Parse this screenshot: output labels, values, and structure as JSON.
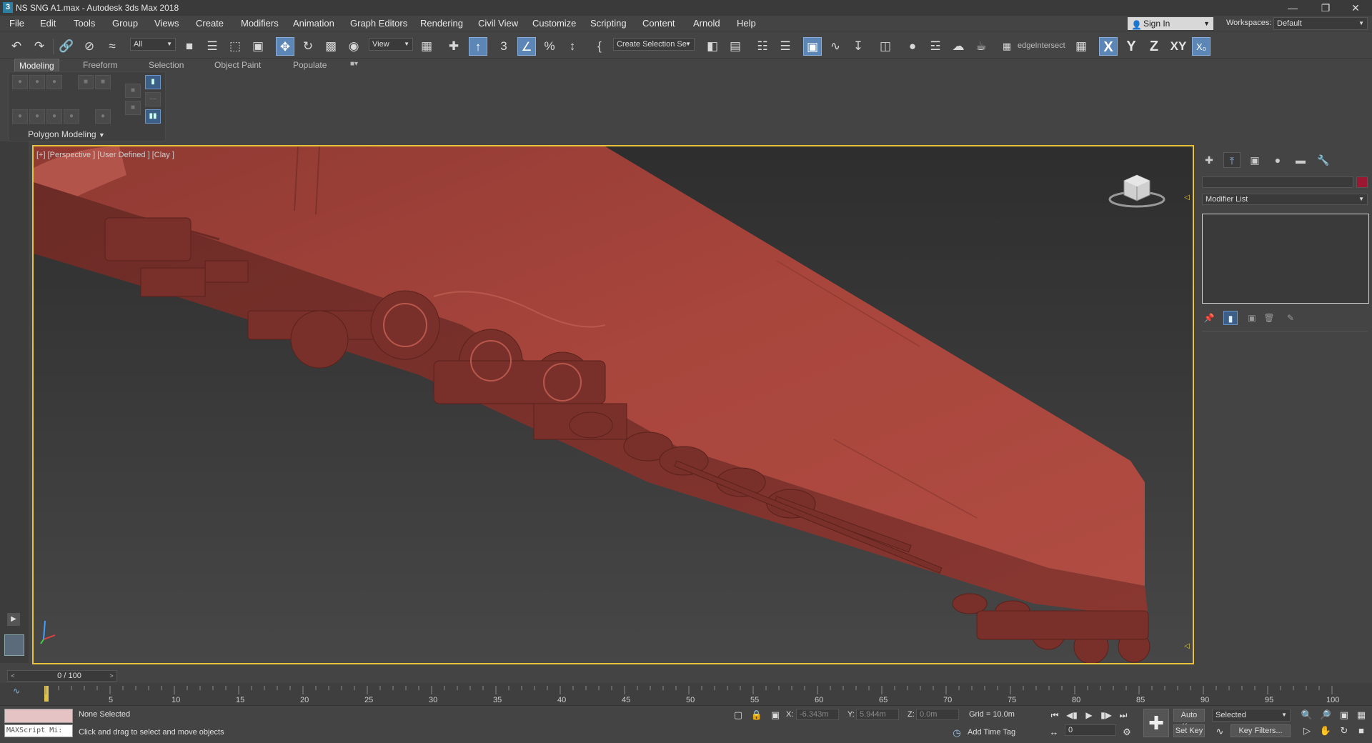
{
  "window": {
    "title": "NS SNG A1.max - Autodesk 3ds Max 2018",
    "app_icon": "3",
    "controls": [
      "minimize",
      "restore",
      "close"
    ]
  },
  "menu": [
    "File",
    "Edit",
    "Tools",
    "Group",
    "Views",
    "Create",
    "Modifiers",
    "Animation",
    "Graph Editors",
    "Rendering",
    "Civil View",
    "Customize",
    "Scripting",
    "Content",
    "Arnold",
    "Help"
  ],
  "account": {
    "sign_in": "Sign In",
    "workspaces_label": "Workspaces:",
    "workspace": "Default"
  },
  "toolbar": {
    "selection_filter": "All",
    "ref_coord": "View",
    "named_selection": "Create Selection Se",
    "edge_intersect": "edgeIntersect",
    "axes": [
      "X",
      "Y",
      "Z",
      "XY"
    ]
  },
  "ribbon": {
    "tabs": [
      "Modeling",
      "Freeform",
      "Selection",
      "Object Paint",
      "Populate"
    ],
    "active_tab": "Modeling",
    "panel_label": "Polygon Modeling"
  },
  "viewport": {
    "label": "[+] [Perspective ] [User Defined ] [Clay ]",
    "model_color": "#a8453c"
  },
  "command_panel": {
    "tabs": [
      "create",
      "modify",
      "hierarchy",
      "motion",
      "display",
      "utilities"
    ],
    "active_tab": "modify",
    "modifier_list": "Modifier List",
    "object_color": "#9b1732"
  },
  "time_slider": {
    "frame": "0 / 100"
  },
  "track_bar": {
    "ticks": [
      "5",
      "10",
      "15",
      "20",
      "25",
      "30",
      "35",
      "40",
      "45",
      "50",
      "55",
      "60",
      "65",
      "70",
      "75",
      "80",
      "85",
      "90",
      "95",
      "100"
    ]
  },
  "status": {
    "maxscript": "MAXScript Mi:",
    "selection": "None Selected",
    "prompt": "Click and drag to select and move objects",
    "x_label": "X:",
    "x_value": "-6.343m",
    "y_label": "Y:",
    "y_value": "5.944m",
    "z_label": "Z:",
    "z_value": "0.0m",
    "grid": "Grid = 10.0m",
    "add_time_tag": "Add Time Tag",
    "auto_key": "Auto Key",
    "set_key": "Set Key",
    "key_mode": "Selected",
    "key_filters": "Key Filters...",
    "current_frame": "0"
  }
}
